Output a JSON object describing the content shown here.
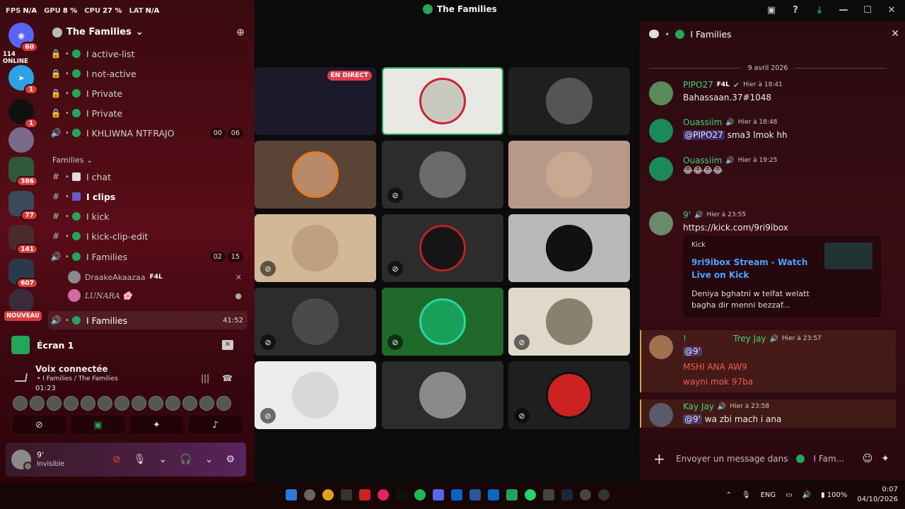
{
  "perf": [
    {
      "label": "FPS",
      "value": "N/A"
    },
    {
      "label": "GPU",
      "value": "8 %"
    },
    {
      "label": "CPU",
      "value": "27 %"
    },
    {
      "label": "LAT",
      "value": "N/A"
    }
  ],
  "window": {
    "title": "The Families"
  },
  "rail": {
    "home_badge": "60",
    "online": "114 ONLINE",
    "badges": [
      "1",
      "1",
      "386",
      "77",
      "141",
      "607"
    ],
    "nouveau": "NOUVEAU"
  },
  "guild": {
    "name": "The Families"
  },
  "channels_top": [
    {
      "name": "I active-list",
      "icon": "lock"
    },
    {
      "name": "I not-active",
      "icon": "lock"
    },
    {
      "name": "I Private",
      "icon": "lock"
    },
    {
      "name": "I Private",
      "icon": "lock"
    },
    {
      "name": "I KHLIWNA NTFRAJO",
      "icon": "speaker",
      "c1": "00",
      "c2": "06"
    }
  ],
  "category": "Families",
  "channels_families": [
    {
      "name": "I chat",
      "icon": "hash"
    },
    {
      "name": "I clips",
      "icon": "hash",
      "bold": true
    },
    {
      "name": "I kick",
      "icon": "hash"
    },
    {
      "name": "I kick-clip-edit",
      "icon": "hash"
    },
    {
      "name": "I Families",
      "icon": "speaker",
      "c1": "02",
      "c2": "15"
    }
  ],
  "voice_users": [
    {
      "name": "DraakeAkaazaa",
      "tag": "F4L"
    },
    {
      "name": "LUNARA 🌸",
      "tag": ""
    }
  ],
  "active_channel": {
    "name": "I Families",
    "time": "41:52"
  },
  "screen": {
    "name": "Écran 1"
  },
  "voice": {
    "title": "Voix connectée",
    "path": "I Families / The Families",
    "time": "01:23"
  },
  "user": {
    "name": "9'",
    "status": "Invisible"
  },
  "grid": {
    "live": "EN DIRECT"
  },
  "chat": {
    "header": "I Families",
    "date": "9 avril 2026",
    "messages": [
      {
        "author": "PIPO27",
        "tag": "F4L",
        "time": "Hier à 18:41",
        "text": "Bahassaan.37#1048"
      },
      {
        "author": "Ouassiim",
        "time": "Hier à 18:48",
        "mention": "@PIPO27",
        "text": "sma3 lmok hh"
      },
      {
        "author": "Ouassiim",
        "time": "Hier à 19:25",
        "text": "😂😂😂😂"
      },
      {
        "author": "9'",
        "time": "Hier à 23:55",
        "link": "https://kick.com/9ri9ibox"
      },
      {
        "author": "Trey Jay",
        "prefix": "!",
        "time": "Hier à 23:57",
        "mention": "@9'",
        "lines": [
          "MSHI ANA AW9",
          "wayni mok 97ba"
        ]
      },
      {
        "author": "Kay Jay",
        "time": "Hier à 23:58",
        "mention": "@9'",
        "text": "wa zbi mach i ana"
      }
    ],
    "embed": {
      "provider": "Kick",
      "title": "9ri9ibox Stream - Watch Live on Kick",
      "desc": "Deniya bghatni w telfat welatt bagha dir menni bezzaf..."
    },
    "composer": {
      "prefix": "Envoyer un message dans",
      "channel": "I Fam..."
    }
  },
  "taskbar": {
    "lang": "ENG",
    "battery": "100%",
    "time": "0:07",
    "date": "04/10/2026"
  },
  "colors": {
    "accent": "#23a55a",
    "danger": "#d93b3b",
    "link": "#4aa3ff"
  }
}
